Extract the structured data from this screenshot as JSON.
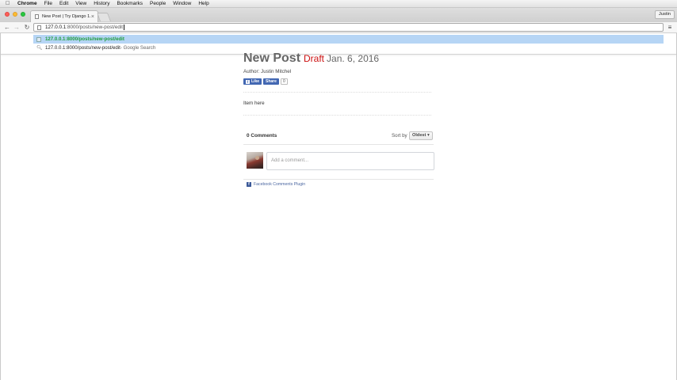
{
  "menubar": {
    "app": "Chrome",
    "items": [
      "File",
      "Edit",
      "View",
      "History",
      "Bookmarks",
      "People",
      "Window",
      "Help"
    ]
  },
  "tab": {
    "title": "New Post | Try Django 1.9",
    "close": "×"
  },
  "profile": {
    "name": "Justin"
  },
  "omnibox": {
    "host": "127.0.0.1",
    "path": ":8000/posts/new-post/edit"
  },
  "suggestions": [
    {
      "url": "127.0.0.1:8000/posts/new-post/edit",
      "desc": ""
    },
    {
      "url": "127.0.0.1:8000/posts/new-post/edit",
      "desc": " - Google Search"
    }
  ],
  "post": {
    "title": "New Post",
    "status": "Draft",
    "date": "Jan. 6, 2016",
    "author": "Author: Justin Mitchel",
    "body": "Item here"
  },
  "social": {
    "like": "Like",
    "share": "Share",
    "count": "0"
  },
  "comments": {
    "count_label": "0 Comments",
    "sort_label": "Sort by",
    "sort_value": "Oldest ▾",
    "placeholder": "Add a comment...",
    "plugin_label": "Facebook Comments Plugin"
  },
  "colors": {
    "draft": "#cc1111",
    "suggestion_highlight": "#b6d5f5",
    "suggestion_url": "#1e9c3b",
    "facebook": "#4267b2"
  }
}
